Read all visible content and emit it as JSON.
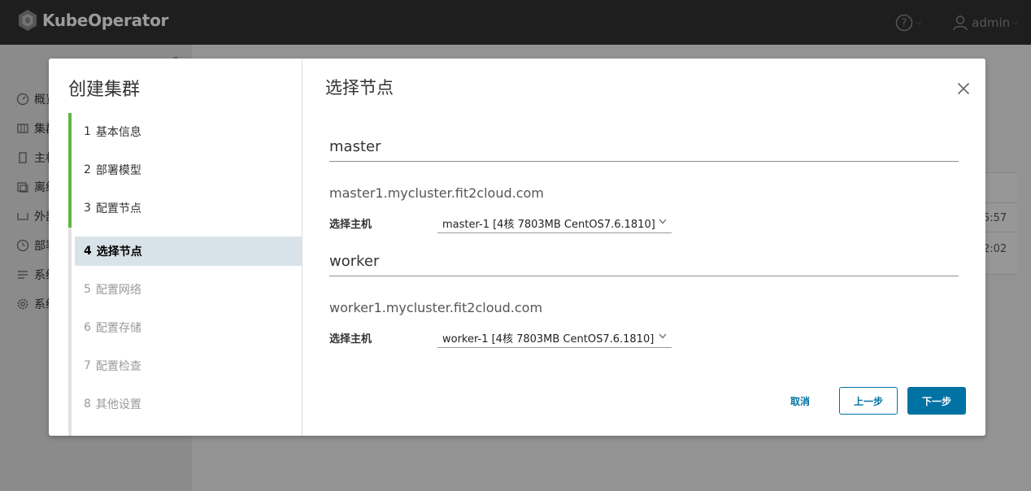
{
  "app": {
    "name": "KubeOperator",
    "user": "admin",
    "nav": [
      "概览",
      "集群",
      "主机",
      "离线",
      "外部",
      "部署",
      "系统",
      "系统"
    ],
    "table_fragments": [
      "5:57",
      "2:02"
    ]
  },
  "wizard": {
    "title": "创建集群",
    "steps": [
      {
        "num": "1",
        "label": "基本信息"
      },
      {
        "num": "2",
        "label": "部署模型"
      },
      {
        "num": "3",
        "label": "配置节点"
      },
      {
        "num": "4",
        "label": "选择节点"
      },
      {
        "num": "5",
        "label": "配置网络"
      },
      {
        "num": "6",
        "label": "配置存储"
      },
      {
        "num": "7",
        "label": "配置检查"
      },
      {
        "num": "8",
        "label": "其他设置"
      }
    ],
    "current_step": 4
  },
  "page": {
    "title": "选择节点",
    "sections": [
      {
        "heading": "master",
        "hostname": "master1.mycluster.fit2cloud.com",
        "field_label": "选择主机",
        "selected": "master-1 [4核 7803MB CentOS7.6.1810]"
      },
      {
        "heading": "worker",
        "hostname": "worker1.mycluster.fit2cloud.com",
        "field_label": "选择主机",
        "selected": "worker-1 [4核 7803MB CentOS7.6.1810]"
      }
    ]
  },
  "footer": {
    "cancel": "取消",
    "prev": "上一步",
    "next": "下一步"
  },
  "colors": {
    "header_bg": "#313131",
    "step_done": "#62b445",
    "step_current_bg": "#d8e3e9",
    "primary": "#0072a3"
  }
}
